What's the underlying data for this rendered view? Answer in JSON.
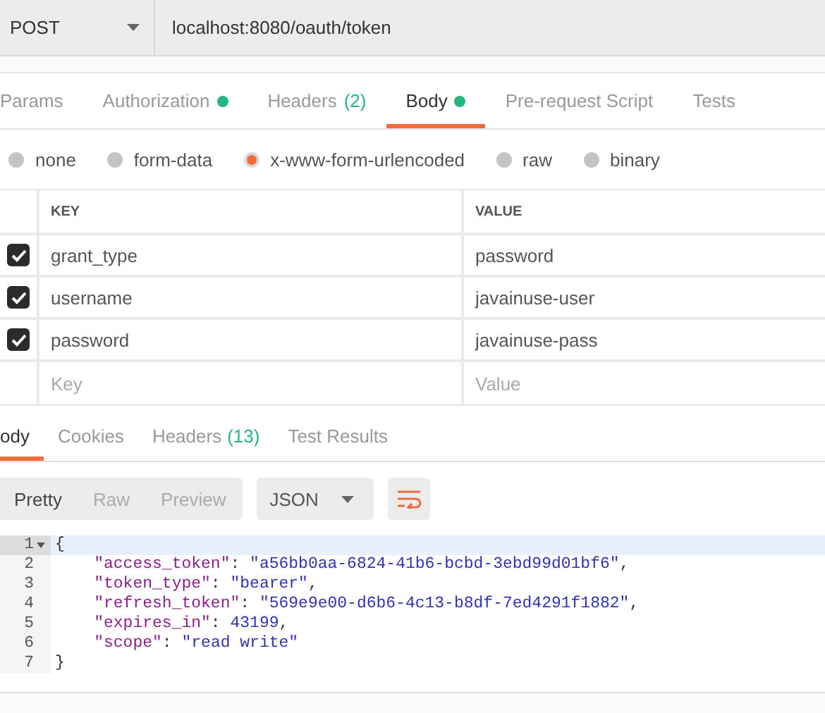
{
  "request": {
    "method": "POST",
    "url": "localhost:8080/oauth/token"
  },
  "request_tabs": [
    {
      "label": "Params",
      "selected": false,
      "dot": false
    },
    {
      "label": "Authorization",
      "selected": false,
      "dot": true
    },
    {
      "label": "Headers",
      "count": "(2)",
      "selected": false,
      "dot": false
    },
    {
      "label": "Body",
      "selected": true,
      "dot": true
    },
    {
      "label": "Pre-request Script",
      "selected": false,
      "dot": false
    },
    {
      "label": "Tests",
      "selected": false,
      "dot": false
    }
  ],
  "body_types": [
    {
      "label": "none",
      "selected": false
    },
    {
      "label": "form-data",
      "selected": false
    },
    {
      "label": "x-www-form-urlencoded",
      "selected": true
    },
    {
      "label": "raw",
      "selected": false
    },
    {
      "label": "binary",
      "selected": false
    }
  ],
  "params_table": {
    "columns": [
      "KEY",
      "VALUE"
    ],
    "rows": [
      {
        "key": "grant_type",
        "value": "password",
        "checked": true
      },
      {
        "key": "username",
        "value": "javainuse-user",
        "checked": true
      },
      {
        "key": "password",
        "value": "javainuse-pass",
        "checked": true
      }
    ],
    "new_row": {
      "key_placeholder": "Key",
      "value_placeholder": "Value"
    }
  },
  "response_tabs": [
    {
      "label": "ody",
      "selected": true
    },
    {
      "label": "Cookies",
      "selected": false
    },
    {
      "label": "Headers",
      "count": "(13)",
      "selected": false
    },
    {
      "label": "Test Results",
      "selected": false
    }
  ],
  "view_modes": [
    {
      "label": "Pretty",
      "selected": true
    },
    {
      "label": "Raw",
      "selected": false
    },
    {
      "label": "Preview",
      "selected": false
    }
  ],
  "format": "JSON",
  "code_lines": [
    {
      "number": "1",
      "fold": true,
      "highlighted": true,
      "parts": [
        {
          "kind": "punct",
          "text": "{"
        }
      ]
    },
    {
      "number": "2",
      "fold": false,
      "highlighted": false,
      "parts": [
        {
          "kind": "key",
          "text": "    \"access_token\""
        },
        {
          "kind": "punct",
          "text": ": "
        },
        {
          "kind": "string",
          "text": "\"a56bb0aa-6824-41b6-bcbd-3ebd99d01bf6\""
        },
        {
          "kind": "punct",
          "text": ","
        }
      ]
    },
    {
      "number": "3",
      "fold": false,
      "highlighted": false,
      "parts": [
        {
          "kind": "key",
          "text": "    \"token_type\""
        },
        {
          "kind": "punct",
          "text": ": "
        },
        {
          "kind": "string",
          "text": "\"bearer\""
        },
        {
          "kind": "punct",
          "text": ","
        }
      ]
    },
    {
      "number": "4",
      "fold": false,
      "highlighted": false,
      "parts": [
        {
          "kind": "key",
          "text": "    \"refresh_token\""
        },
        {
          "kind": "punct",
          "text": ": "
        },
        {
          "kind": "string",
          "text": "\"569e9e00-d6b6-4c13-b8df-7ed4291f1882\""
        },
        {
          "kind": "punct",
          "text": ","
        }
      ]
    },
    {
      "number": "5",
      "fold": false,
      "highlighted": false,
      "parts": [
        {
          "kind": "key",
          "text": "    \"expires_in\""
        },
        {
          "kind": "punct",
          "text": ": "
        },
        {
          "kind": "number",
          "text": "43199"
        },
        {
          "kind": "punct",
          "text": ","
        }
      ]
    },
    {
      "number": "6",
      "fold": false,
      "highlighted": false,
      "parts": [
        {
          "kind": "key",
          "text": "    \"scope\""
        },
        {
          "kind": "punct",
          "text": ": "
        },
        {
          "kind": "string",
          "text": "\"read write\""
        }
      ]
    },
    {
      "number": "7",
      "fold": false,
      "highlighted": false,
      "parts": [
        {
          "kind": "punct",
          "text": "}"
        }
      ]
    }
  ]
}
